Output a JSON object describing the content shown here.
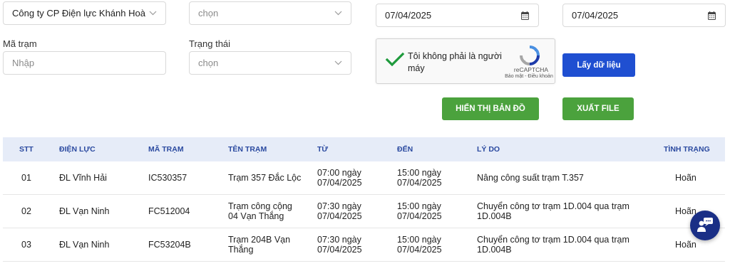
{
  "filters": {
    "company_value": "Công ty CP Điện lực Khánh Hoà",
    "unit_placeholder": "chọn",
    "from_date": "07/04/2025",
    "to_date": "07/04/2025",
    "station_code_label": "Mã trạm",
    "station_code_placeholder": "Nhập",
    "status_label": "Trạng thái",
    "status_placeholder": "chọn"
  },
  "captcha": {
    "text": "Tôi không phải là người máy",
    "brand": "reCAPTCHA",
    "links": "Bảo mật - Điều khoản"
  },
  "buttons": {
    "fetch": "Lấy dữ liệu",
    "show_map": "HIỂN THỊ BẢN ĐỒ",
    "export": "XUẤT FILE"
  },
  "table": {
    "headers": [
      "STT",
      "ĐIỆN LỰC",
      "MÃ TRẠM",
      "TÊN TRẠM",
      "TỪ",
      "ĐẾN",
      "LÝ DO",
      "TÌNH TRẠNG"
    ],
    "rows": [
      {
        "stt": "01",
        "dien_luc": "ĐL Vĩnh Hải",
        "ma_tram": "IC530357",
        "ten_tram": "Trạm 357 Đắc Lộc",
        "tu_time": "07:00 ngày",
        "tu_date": "07/04/2025",
        "den_time": "15:00 ngày",
        "den_date": "07/04/2025",
        "ly_do_1": "Nâng công suất trạm T.357",
        "ly_do_2": "",
        "tinh_trang": "Hoãn"
      },
      {
        "stt": "02",
        "dien_luc": "ĐL Vạn Ninh",
        "ma_tram": "FC512004",
        "ten_tram_1": "Trạm công cộng",
        "ten_tram_2": "04 Vạn Thắng",
        "tu_time": "07:30 ngày",
        "tu_date": "07/04/2025",
        "den_time": "15:00 ngày",
        "den_date": "07/04/2025",
        "ly_do_1": "Chuyển công tơ trạm 1D.004 qua trạm",
        "ly_do_2": "1D.004B",
        "tinh_trang": "Hoãn"
      },
      {
        "stt": "03",
        "dien_luc": "ĐL Vạn Ninh",
        "ma_tram": "FC53204B",
        "ten_tram_1": "Trạm 204B Vạn",
        "ten_tram_2": "Thắng",
        "tu_time": "07:30 ngày",
        "tu_date": "07/04/2025",
        "den_time": "15:00 ngày",
        "den_date": "07/04/2025",
        "ly_do_1": "Chuyển công tơ trạm 1D.004 qua trạm",
        "ly_do_2": "1D.004B",
        "tinh_trang": "Hoãn"
      }
    ]
  },
  "icons": {
    "chevron": "chevron-down-icon",
    "calendar": "calendar-icon",
    "chat": "chat-support-icon"
  },
  "colors": {
    "primary_blue": "#1f4fd1",
    "green": "#4ba23d",
    "header_bg": "#e6ecf8",
    "header_text": "#2b4aa0",
    "fab_bg": "#1a2f86"
  }
}
